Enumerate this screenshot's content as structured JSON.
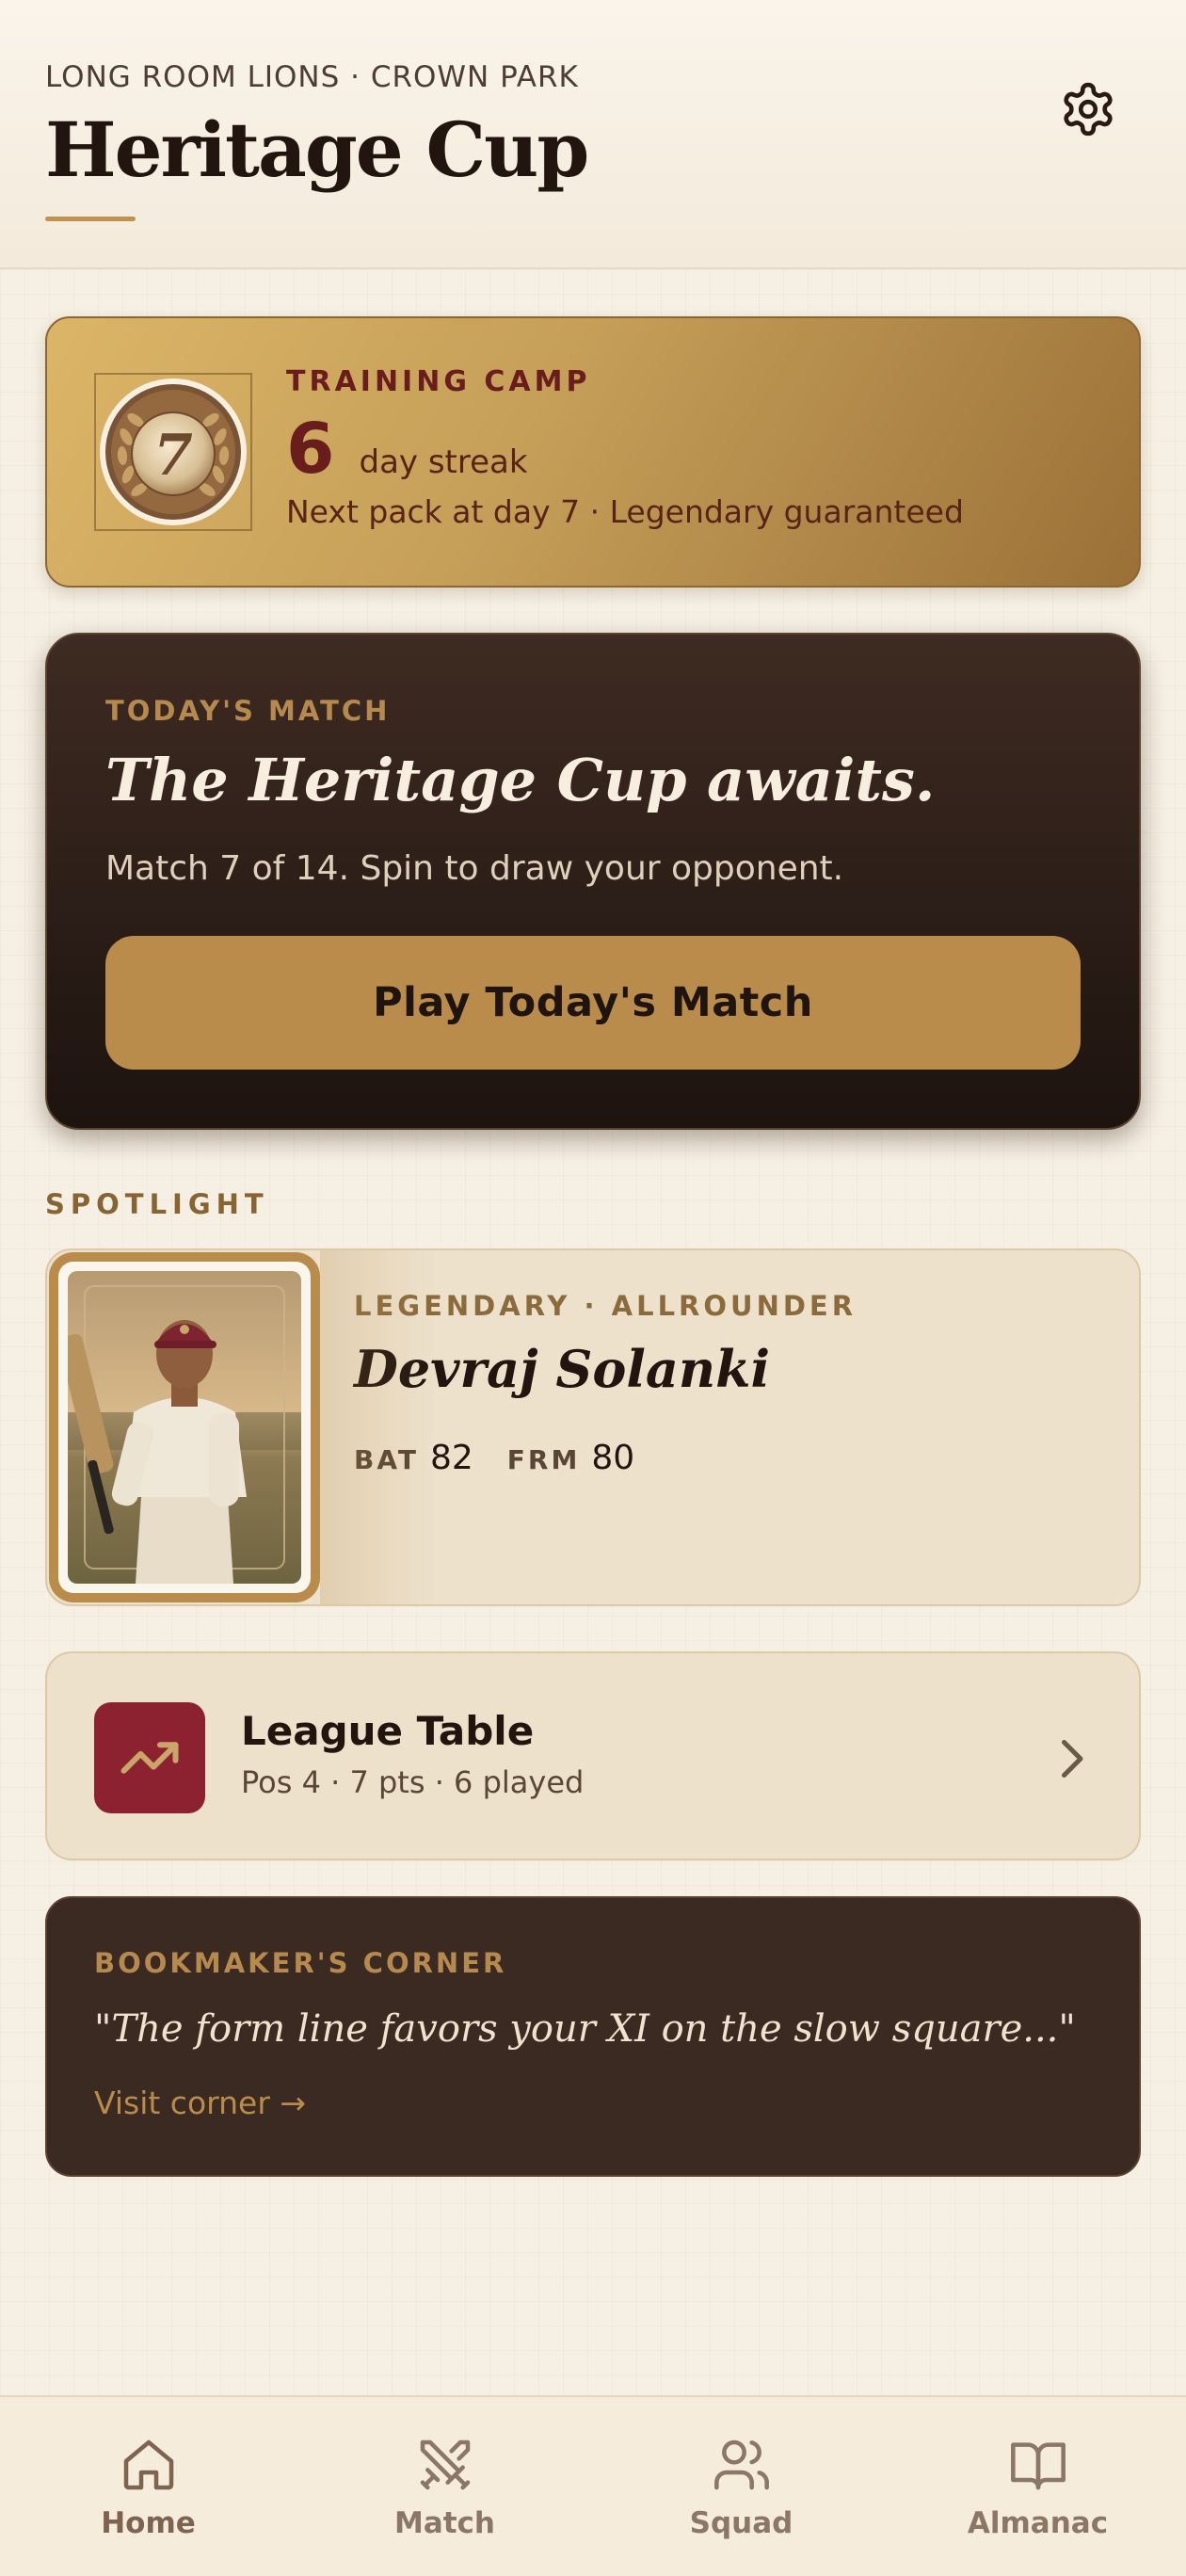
{
  "header": {
    "subtitle": "LONG ROOM LIONS · CROWN PARK",
    "title": "Heritage Cup",
    "settings_icon": "gear-icon"
  },
  "training": {
    "label": "TRAINING CAMP",
    "medal_number": "7",
    "streak_number": "6",
    "streak_unit": "day streak",
    "next": "Next pack at day 7 · Legendary guaranteed"
  },
  "match": {
    "label": "TODAY'S MATCH",
    "title": "The Heritage Cup awaits.",
    "subtitle": "Match 7 of 14. Spin to draw your opponent.",
    "button_label": "Play Today's Match"
  },
  "spotlight": {
    "section_label": "SPOTLIGHT",
    "rarity": "LEGENDARY · ALLROUNDER",
    "name": "Devraj Solanki",
    "stats": [
      {
        "label": "BAT",
        "value": "82"
      },
      {
        "label": "FRM",
        "value": "80"
      }
    ]
  },
  "league": {
    "title": "League Table",
    "subtitle": "Pos 4 · 7 pts · 6 played",
    "icon": "trending-up-icon"
  },
  "bookmaker": {
    "label": "BOOKMAKER'S CORNER",
    "quote": "\"The form line favors your XI on the slow square...\"",
    "link": "Visit corner →"
  },
  "nav": {
    "items": [
      {
        "label": "Home",
        "icon": "home-icon",
        "active": true
      },
      {
        "label": "Match",
        "icon": "crossed-bats-icon"
      },
      {
        "label": "Squad",
        "icon": "users-icon"
      },
      {
        "label": "Almanac",
        "icon": "book-icon"
      }
    ]
  },
  "colors": {
    "background": "#f6efe3",
    "gold": "#b98c4c",
    "maroon": "#8c2130",
    "dark_brown": "#3b2a21"
  }
}
